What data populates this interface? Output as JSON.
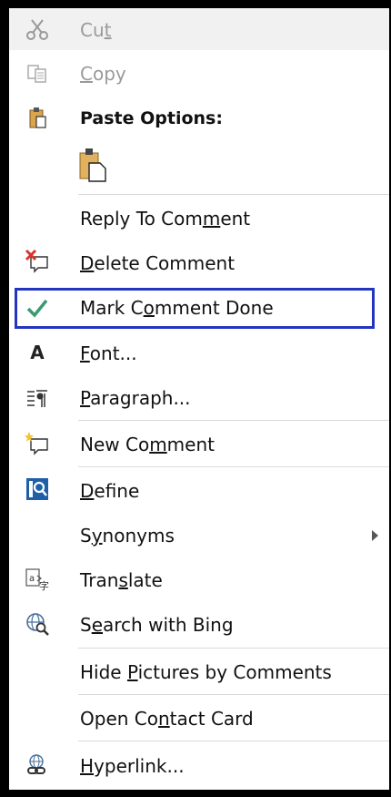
{
  "menu": {
    "cut": {
      "pre": "Cu",
      "key": "t",
      "post": "",
      "icon": "scissors-icon"
    },
    "copy": {
      "pre": "",
      "key": "C",
      "post": "opy",
      "icon": "copy-icon"
    },
    "paste_options": {
      "label": "Paste Options:",
      "icon": "clipboard-icon"
    },
    "paste_button_icon": "paste-keep-text-icon",
    "reply": {
      "pre": "Reply To Com",
      "key": "m",
      "post": "ent"
    },
    "delete": {
      "pre": "",
      "key": "D",
      "post": "elete Comment",
      "icon": "delete-comment-icon"
    },
    "mark_done": {
      "pre": "Mark C",
      "key": "o",
      "post": "mment Done",
      "icon": "checkmark-icon"
    },
    "font": {
      "pre": "",
      "key": "F",
      "post": "ont...",
      "icon": "font-icon",
      "glyph": "A"
    },
    "paragraph": {
      "pre": "",
      "key": "P",
      "post": "aragraph...",
      "icon": "paragraph-icon"
    },
    "new_comment": {
      "pre": "New Co",
      "key": "m",
      "post": "ment",
      "icon": "new-comment-icon"
    },
    "define": {
      "pre": "",
      "key": "D",
      "post": "efine",
      "icon": "define-icon"
    },
    "synonyms": {
      "pre": "S",
      "key": "y",
      "post": "nonyms"
    },
    "translate": {
      "pre": "Tran",
      "key": "s",
      "post": "late",
      "icon": "translate-icon"
    },
    "search_bing": {
      "pre": "S",
      "key": "e",
      "post": "arch with Bing",
      "icon": "search-globe-icon"
    },
    "hide_pictures": {
      "pre": "Hide ",
      "key": "P",
      "post": "ictures by Comments"
    },
    "open_contact": {
      "pre": "Open Co",
      "key": "n",
      "post": "tact Card"
    },
    "hyperlink": {
      "pre": "",
      "key": "H",
      "post": "yperlink...",
      "icon": "hyperlink-icon"
    }
  },
  "colors": {
    "highlight_border": "#2335c0",
    "check_green": "#3a9b6f",
    "delete_red": "#d9342b",
    "define_blue": "#1e5fa8",
    "disabled_text": "#9a9a9a"
  }
}
